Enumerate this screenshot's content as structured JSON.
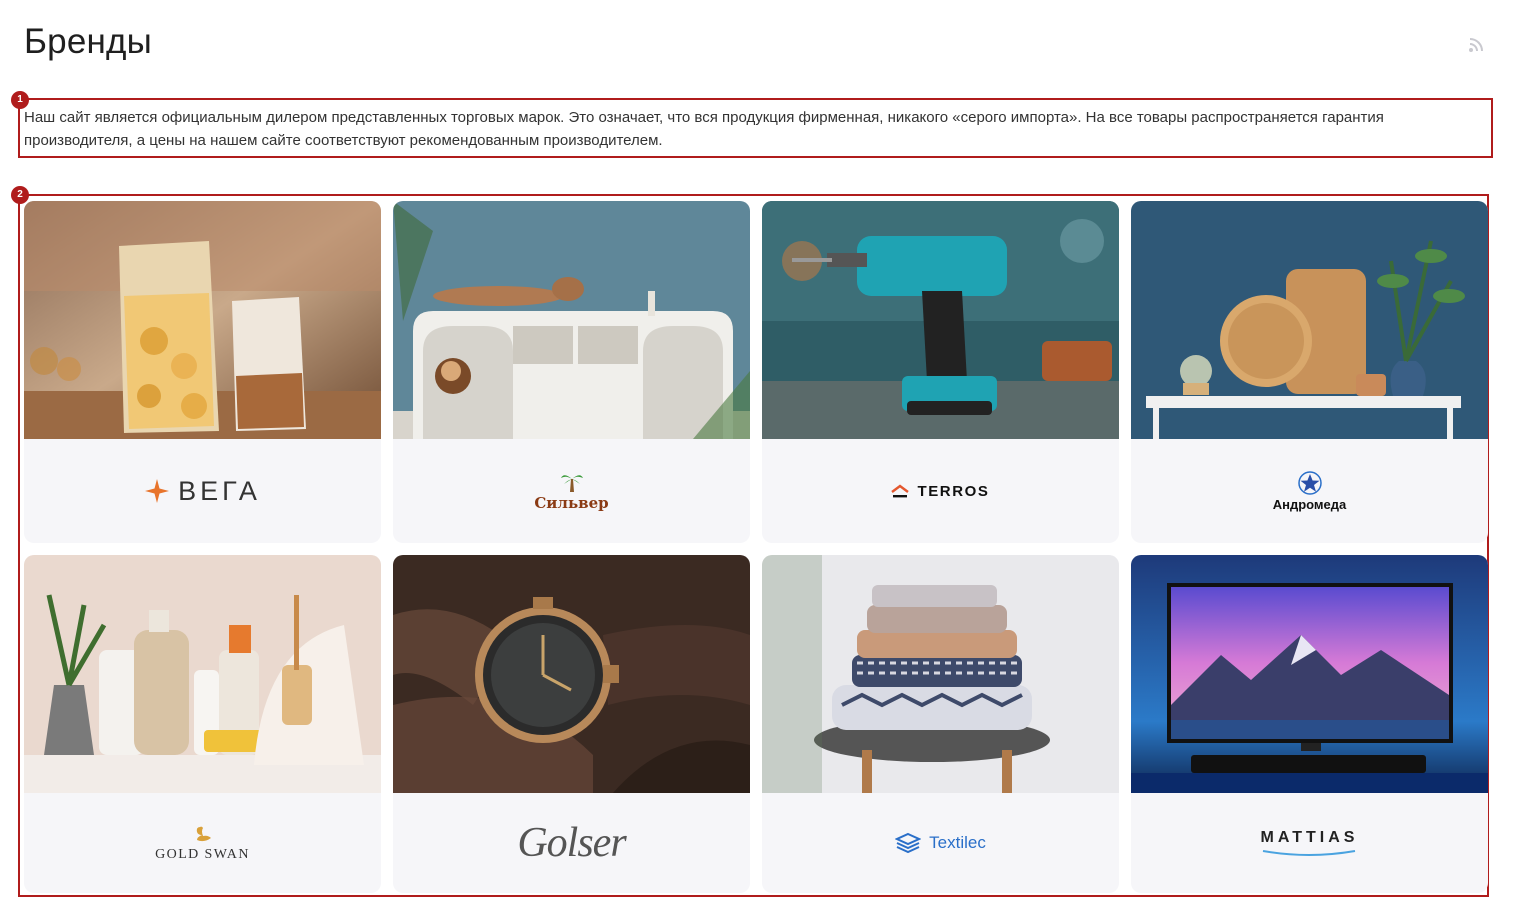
{
  "page": {
    "title": "Бренды",
    "intro": "Наш сайт является официальным дилером представленных торговых марок. Это означает, что вся продукция фирменная, никакого «серого импорта». На все товары распространяется гарантия производителя, а цены на нашем сайте соответствуют рекомендованным производителем."
  },
  "annotations": [
    {
      "number": "1"
    },
    {
      "number": "2"
    }
  ],
  "brands": [
    {
      "name": "ВЕГА",
      "icon": "star-spark-icon",
      "image": "snacks-packaging-photo"
    },
    {
      "name": "Сильвер",
      "icon": "palm-tree-icon",
      "image": "toy-shelf-photo"
    },
    {
      "name": "TERROS",
      "icon": "house-roof-icon",
      "image": "cordless-drill-photo"
    },
    {
      "name": "Андромеда",
      "icon": "star-circle-icon",
      "image": "cutting-boards-photo"
    },
    {
      "name": "GOLD SWAN",
      "icon": "swan-icon",
      "image": "cleaning-supplies-photo"
    },
    {
      "name": "Golser",
      "icon": "",
      "image": "wristwatch-photo"
    },
    {
      "name": "Textilec",
      "icon": "layers-icon",
      "image": "folded-textiles-photo"
    },
    {
      "name": "MATTIAS",
      "icon": "smile-arc-icon",
      "image": "television-photo"
    }
  ],
  "colors": {
    "annotation": "#b01c1c",
    "card_bg": "#f6f6f9",
    "vega_accent": "#e8742c",
    "silver_accent": "#8a3a14",
    "textilec_accent": "#2a6fc9"
  }
}
